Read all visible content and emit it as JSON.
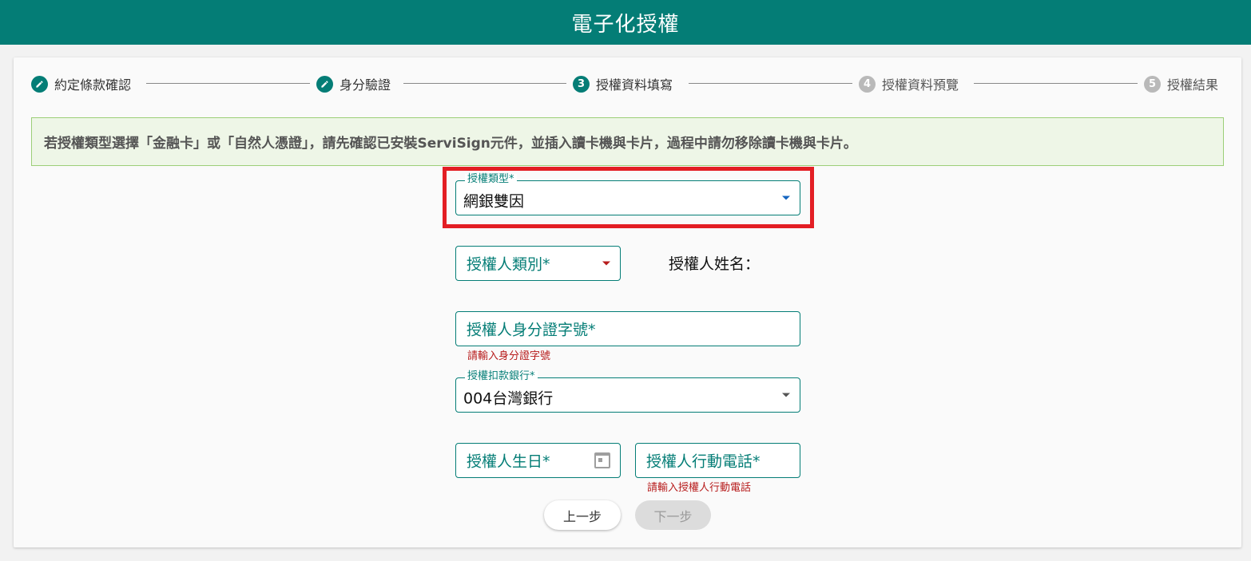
{
  "header": {
    "title": "電子化授權"
  },
  "stepper": {
    "steps": [
      {
        "label": "約定條款確認",
        "state": "done",
        "icon": "pencil-icon"
      },
      {
        "label": "身分驗證",
        "state": "done",
        "icon": "pencil-icon"
      },
      {
        "label": "授權資料填寫",
        "state": "active",
        "number": "3"
      },
      {
        "label": "授權資料預覽",
        "state": "pending",
        "number": "4"
      },
      {
        "label": "授權結果",
        "state": "pending",
        "number": "5"
      }
    ]
  },
  "notice": {
    "text": "若授權類型選擇「金融卡」或「自然人憑證」，請先確認已安裝ServiSign元件，並插入讀卡機與卡片，過程中請勿移除讀卡機與卡片。"
  },
  "form": {
    "auth_type": {
      "label": "授權類型*",
      "value": "網銀雙因"
    },
    "authorizer_category": {
      "placeholder": "授權人類別*"
    },
    "authorizer_name": {
      "label": "授權人姓名："
    },
    "authorizer_id": {
      "placeholder": "授權人身分證字號*",
      "error": "請輸入身分證字號"
    },
    "debit_bank": {
      "label": "授權扣款銀行*",
      "value": "004台灣銀行"
    },
    "birthday": {
      "placeholder": "授權人生日*"
    },
    "mobile": {
      "placeholder": "授權人行動電話*",
      "error": "請輸入授權人行動電話"
    }
  },
  "buttons": {
    "prev": "上一步",
    "next": "下一步"
  },
  "colors": {
    "primary": "#047d76",
    "error": "#b71c1c",
    "highlight": "#e31e24"
  }
}
